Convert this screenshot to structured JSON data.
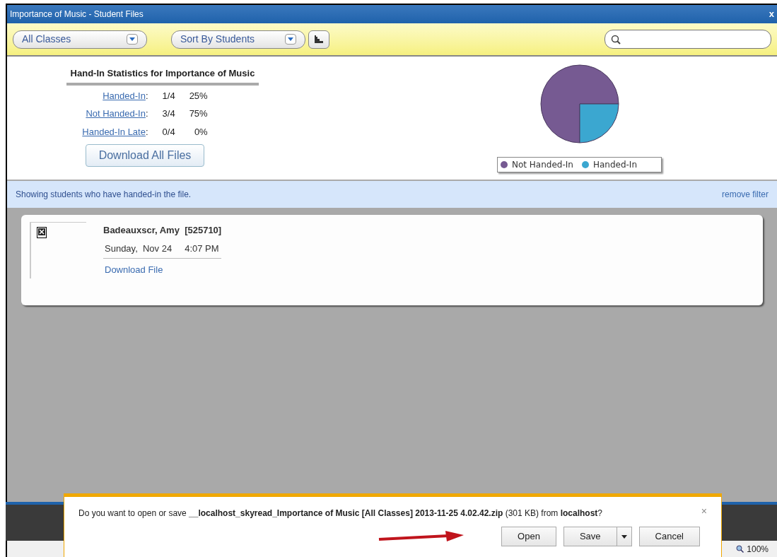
{
  "window": {
    "title": "Importance of Music - Student Files",
    "close": "x"
  },
  "toolbar": {
    "class_filter": "All Classes",
    "sort": "Sort By Students"
  },
  "stats": {
    "title": "Hand-In Statistics for Importance of Music",
    "rows": [
      {
        "label": "Handed-In",
        "colon": ":",
        "count": "1/4",
        "percent": "25%"
      },
      {
        "label": "Not Handed-In",
        "colon": ":",
        "count": "3/4",
        "percent": "75%"
      },
      {
        "label": "Handed-In Late",
        "colon": ":",
        "count": "0/4",
        "percent": "0%"
      }
    ],
    "download_all": "Download All Files"
  },
  "chart": {
    "chart_data": {
      "type": "pie",
      "categories": [
        "Not Handed-In",
        "Handed-In"
      ],
      "values": [
        75,
        25
      ]
    },
    "legend": [
      {
        "color": "#765a92"
      },
      {
        "color": "#3ba7d0"
      }
    ]
  },
  "filter_bar": {
    "message": "Showing students who have handed-in the file.",
    "remove": "remove filter"
  },
  "students": [
    {
      "name": "Badeauxscr, Amy  [525710]",
      "day": "Sunday,  Nov 24",
      "time": "4:07 PM",
      "download": "Download File"
    }
  ],
  "download_prompt": {
    "message": "Do you want to open or save **__localhost_skyread_Importance of Music [All Classes] 2013-11-25  4.02.42.zip** (301 KB) from **localhost**?",
    "close": "×",
    "buttons": [
      "Open",
      "Save",
      "Cancel"
    ]
  },
  "status_bar": {
    "zoom": "100%"
  }
}
